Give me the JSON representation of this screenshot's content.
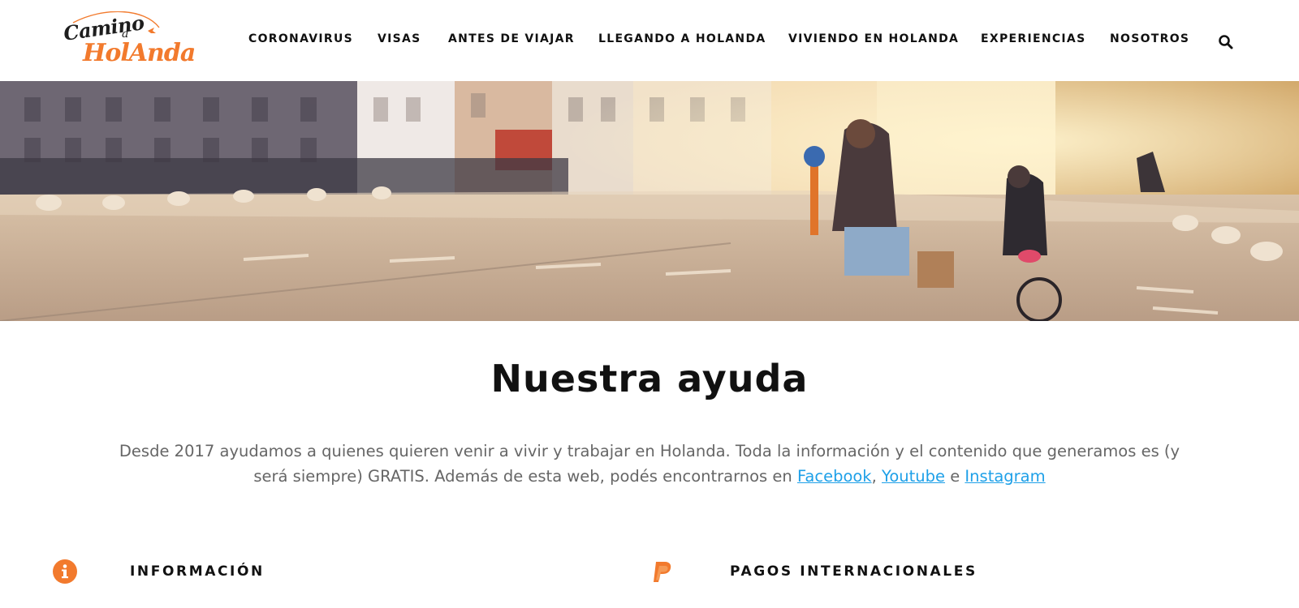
{
  "brand": {
    "logo_line1": "Camino",
    "logo_line2": "a",
    "logo_line3": "HolAnda",
    "accent_color": "#f27a2d"
  },
  "nav": {
    "items": [
      {
        "label": "CORONAVIRUS"
      },
      {
        "label": "VISAS"
      },
      {
        "label": "ANTES DE VIAJAR"
      },
      {
        "label": "LLEGANDO A HOLANDA"
      },
      {
        "label": "VIVIENDO EN HOLANDA"
      },
      {
        "label": "EXPERIENCIAS"
      },
      {
        "label": "NOSOTROS"
      }
    ],
    "search_icon": "search-icon"
  },
  "main": {
    "title": "Nuestra ayuda",
    "intro": {
      "text_before": "Desde 2017 ayudamos a quienes quieren venir a vivir y trabajar en Holanda. Toda la información y el contenido que generamos es (y será siempre) GRATIS. Además de esta web, podés encontrarnos en ",
      "link_facebook": "Facebook",
      "sep_comma": ", ",
      "link_youtube": "Youtube",
      "sep_and": " e ",
      "link_instagram": "Instagram",
      "link_color": "#1ea0e8"
    },
    "features": [
      {
        "icon": "info-circle-icon",
        "title": "INFORMACIÓN"
      },
      {
        "icon": "paypal-icon",
        "title": "PAGOS INTERNACIONALES"
      }
    ]
  }
}
